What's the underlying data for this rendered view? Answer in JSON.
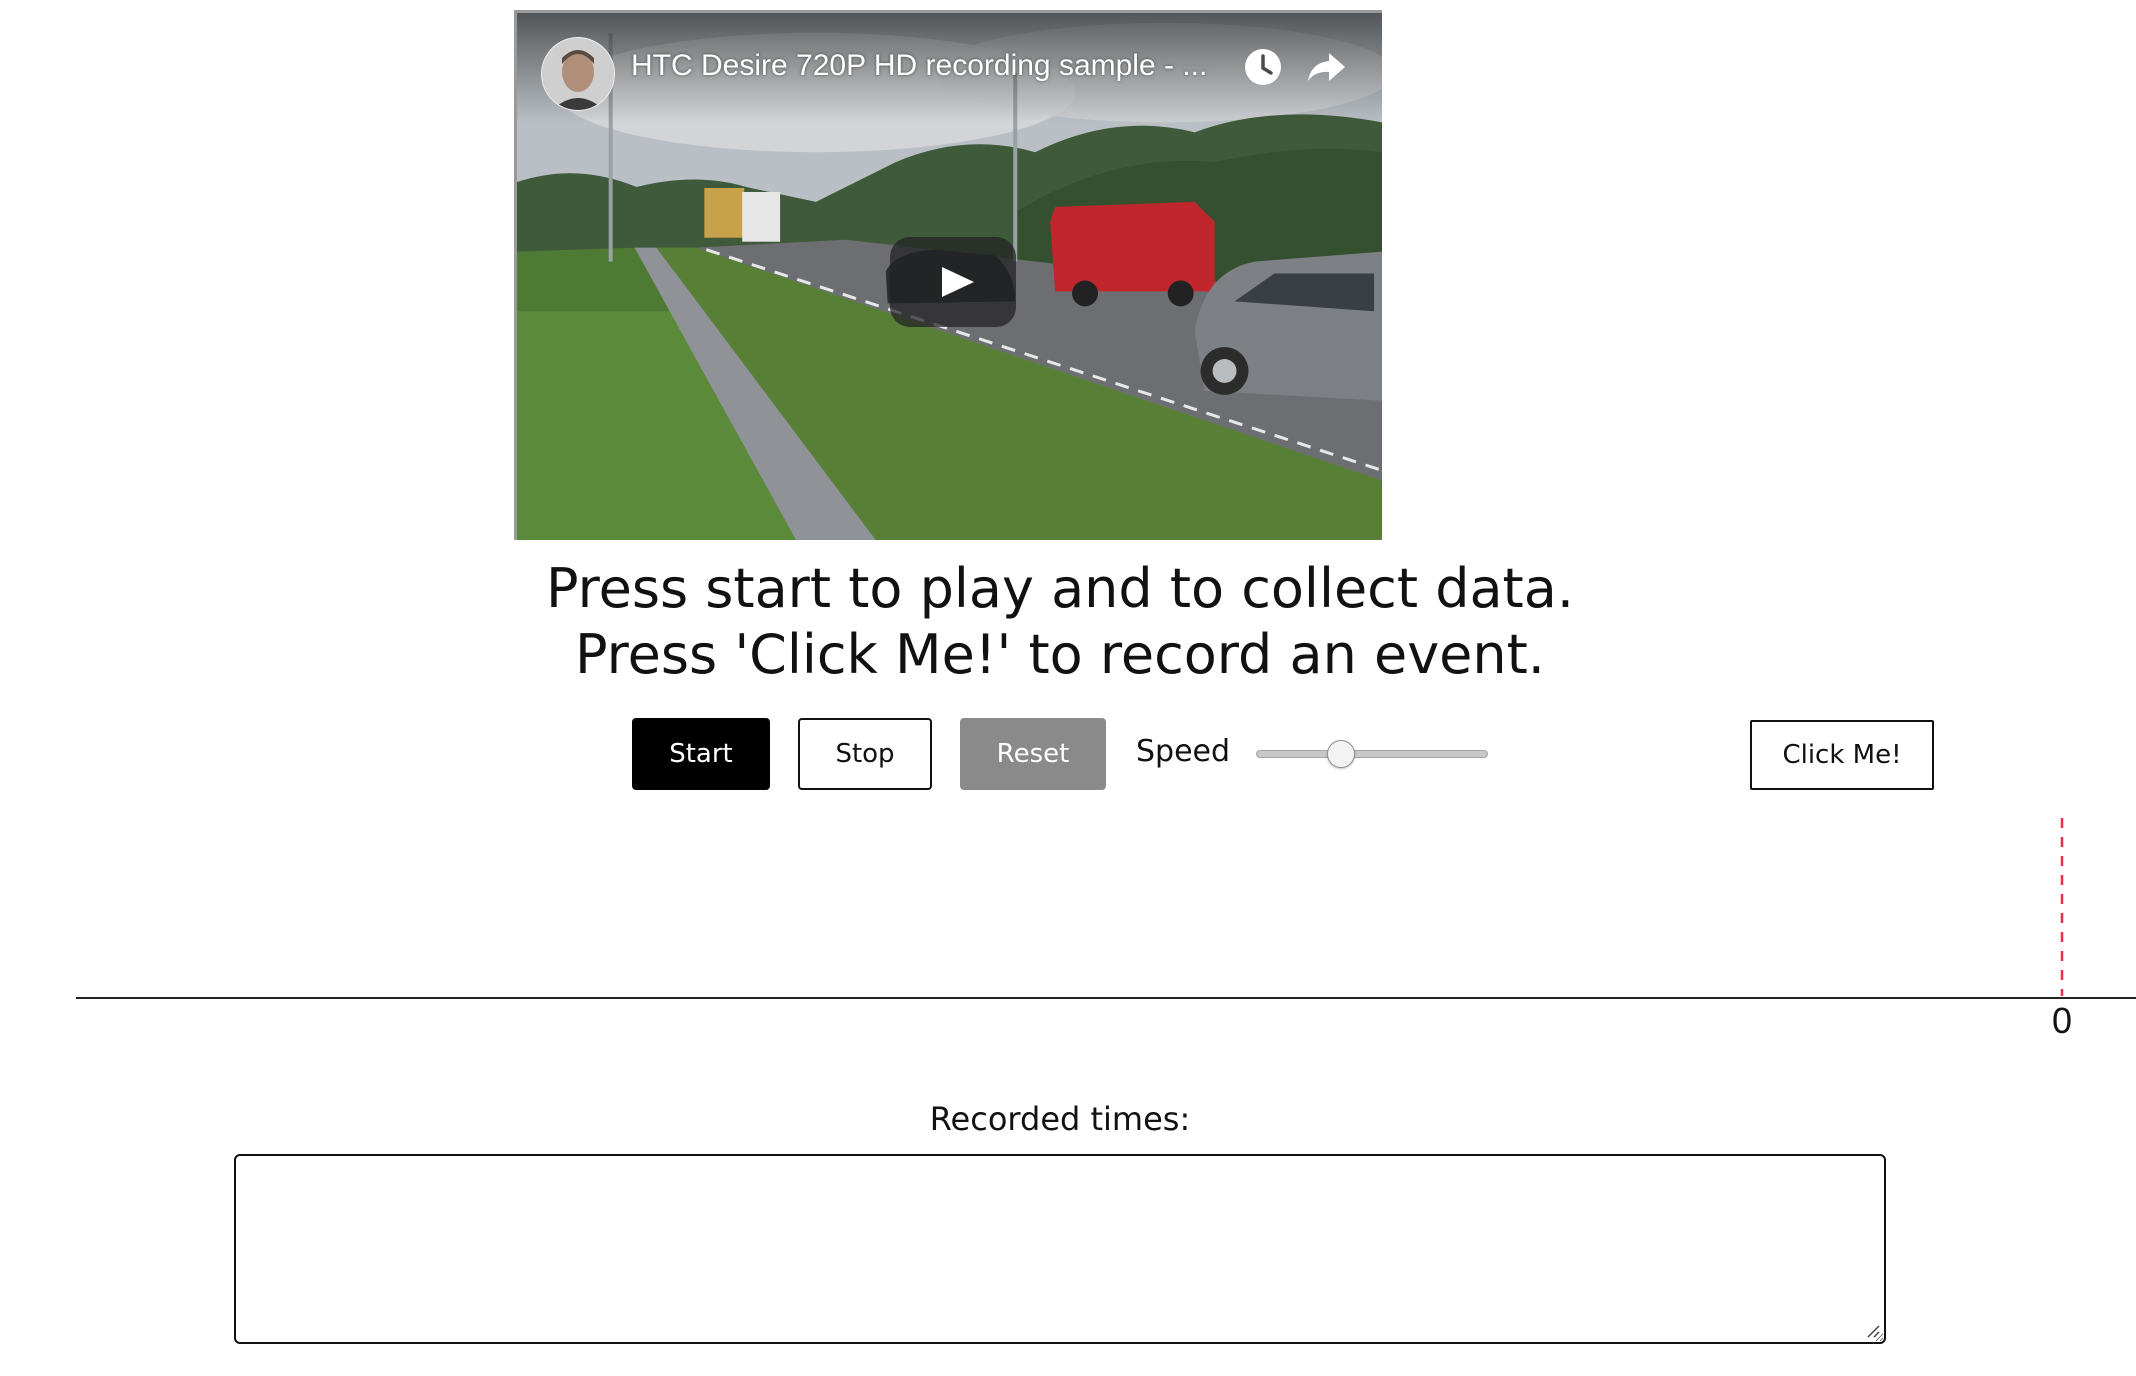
{
  "video": {
    "title": "HTC Desire 720P HD recording sample - ...",
    "icons": {
      "avatar": "channel-avatar",
      "watch_later": "clock-icon",
      "share": "share-arrow-icon",
      "play": "play-icon"
    }
  },
  "instructions": {
    "line1": "Press start to play and to collect data.",
    "line2": "Press 'Click Me!' to record an event."
  },
  "controls": {
    "start_label": "Start",
    "stop_label": "Stop",
    "reset_label": "Reset",
    "speed_label": "Speed",
    "speed_fraction": 0.35,
    "click_label": "Click Me!"
  },
  "timeline": {
    "current_value": "0",
    "marker_color": "#e8304b"
  },
  "recorded": {
    "label": "Recorded times:",
    "value": ""
  },
  "colors": {
    "start_bg": "#000000",
    "reset_bg": "#8a8a8a"
  }
}
